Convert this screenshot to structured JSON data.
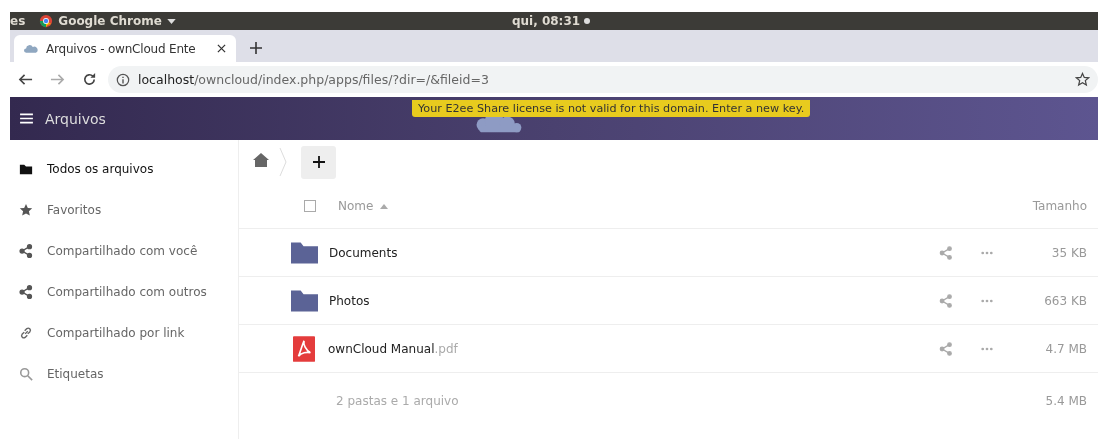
{
  "top_panel": {
    "app_menu_left": "es",
    "app_name": "Google Chrome",
    "clock": "qui, 08:31"
  },
  "browser": {
    "tabs": [
      {
        "title": "Arquivos - ownCloud Ente",
        "selected": true
      }
    ],
    "url_host": "localhost",
    "url_path": "/owncloud/index.php/apps/files/?dir=/&fileid=3"
  },
  "header": {
    "app_title": "Arquivos",
    "notification": "Your E2ee Share license is not valid for this domain. Enter a new key."
  },
  "sidebar": {
    "items": [
      {
        "label": "Todos os arquivos",
        "kind": "folder",
        "selected": true
      },
      {
        "label": "Favoritos",
        "kind": "star",
        "selected": false
      },
      {
        "label": "Compartilhado com você",
        "kind": "share",
        "selected": false
      },
      {
        "label": "Compartilhado com outros",
        "kind": "share",
        "selected": false
      },
      {
        "label": "Compartilhado por link",
        "kind": "link",
        "selected": false
      },
      {
        "label": "Etiquetas",
        "kind": "search",
        "selected": false
      }
    ]
  },
  "files": {
    "select_all": {
      "checked": false
    },
    "columns": {
      "name": "Nome",
      "size": "Tamanho"
    },
    "rows": [
      {
        "kind": "folder",
        "name": "Documents",
        "size": "35 KB"
      },
      {
        "kind": "folder",
        "name": "Photos",
        "size": "663 KB"
      },
      {
        "kind": "pdf",
        "name": "ownCloud Manual",
        "extension": ".pdf",
        "size": "4.7 MB"
      }
    ],
    "summary": "2 pastas e 1 arquivo",
    "total_size": "5.4 MB"
  }
}
